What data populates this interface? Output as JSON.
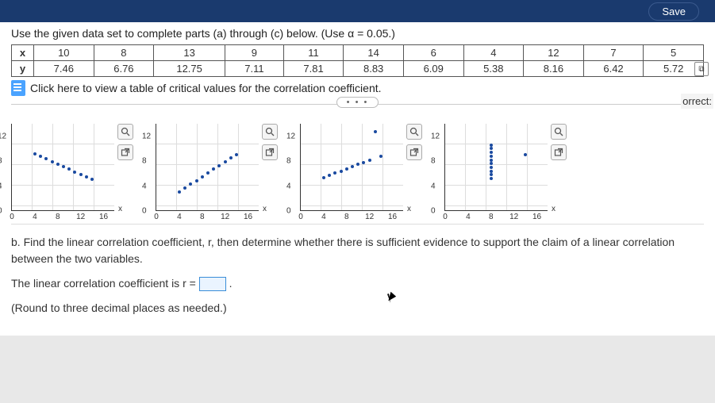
{
  "topbar": {
    "save": "Save"
  },
  "prompt": "Use the given data set to complete parts (a) through (c) below. (Use α = 0.05.)",
  "table": {
    "row_x_label": "x",
    "row_y_label": "y",
    "x": [
      "10",
      "8",
      "13",
      "9",
      "11",
      "14",
      "6",
      "4",
      "12",
      "7",
      "5"
    ],
    "y": [
      "7.46",
      "6.76",
      "12.75",
      "7.11",
      "7.81",
      "8.83",
      "6.09",
      "5.38",
      "8.16",
      "6.42",
      "5.72"
    ]
  },
  "link": "Click here to view a table of critical values for the correlation coefficient.",
  "pill": "• • •",
  "side": "orrect:",
  "charts": {
    "yticks": [
      "12",
      "8",
      "4",
      "0"
    ],
    "xticks": [
      "0",
      "4",
      "8",
      "12",
      "16"
    ],
    "xlabel": "x"
  },
  "partb": {
    "text": "b. Find the linear correlation coefficient, r, then determine whether there is sufficient evidence to support the claim of a linear correlation between the two variables.",
    "line2a": "The linear correlation coefficient is r = ",
    "line2b": ".",
    "line3": "(Round to three decimal places as needed.)"
  },
  "chart_data": [
    {
      "type": "scatter",
      "title": "",
      "xlabel": "x",
      "ylabel": "",
      "xlim": [
        0,
        18
      ],
      "ylim": [
        0,
        14
      ],
      "x": [
        4,
        5,
        6,
        7,
        8,
        9,
        10,
        11,
        12,
        13,
        14
      ],
      "y": [
        9.2,
        8.8,
        8.4,
        7.9,
        7.5,
        7.1,
        6.7,
        6.3,
        5.9,
        5.5,
        5.1
      ]
    },
    {
      "type": "scatter",
      "title": "",
      "xlabel": "x",
      "ylabel": "",
      "xlim": [
        0,
        18
      ],
      "ylim": [
        0,
        14
      ],
      "x": [
        4,
        5,
        6,
        7,
        8,
        9,
        10,
        11,
        12,
        13,
        14
      ],
      "y": [
        3.1,
        3.7,
        4.3,
        4.9,
        5.5,
        6.1,
        6.7,
        7.3,
        7.9,
        8.5,
        9.1
      ]
    },
    {
      "type": "scatter",
      "title": "",
      "xlabel": "x",
      "ylabel": "",
      "xlim": [
        0,
        18
      ],
      "ylim": [
        0,
        14
      ],
      "x": [
        4,
        5,
        6,
        7,
        8,
        9,
        10,
        11,
        12,
        13,
        14
      ],
      "y": [
        5.38,
        5.72,
        6.09,
        6.42,
        6.76,
        7.11,
        7.46,
        7.81,
        8.16,
        12.75,
        8.83
      ]
    },
    {
      "type": "scatter",
      "title": "",
      "xlabel": "x",
      "ylabel": "",
      "xlim": [
        0,
        18
      ],
      "ylim": [
        0,
        14
      ],
      "x": [
        8,
        8,
        8,
        8,
        8,
        8,
        8,
        8,
        8,
        8,
        14
      ],
      "y": [
        5.2,
        5.8,
        6.4,
        7.0,
        7.6,
        8.2,
        8.8,
        9.4,
        10.0,
        10.6,
        9.0
      ]
    }
  ]
}
